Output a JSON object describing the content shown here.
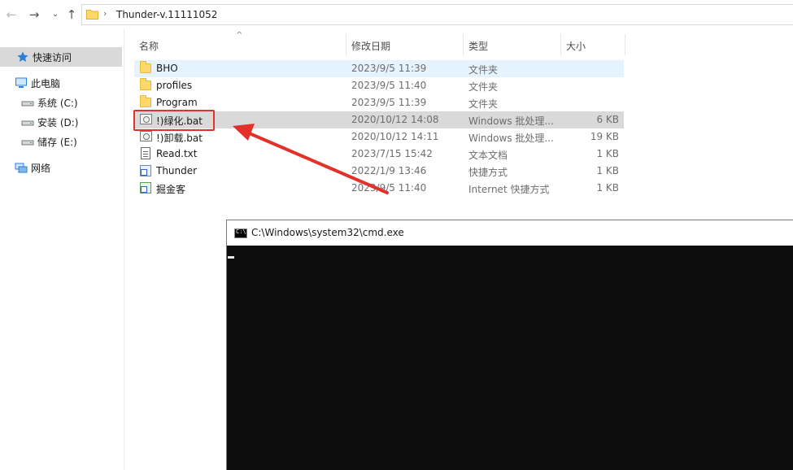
{
  "address": {
    "path": "Thunder-v.11111052"
  },
  "sidebar": {
    "items": [
      {
        "label": "快速访问",
        "icon": "star-icon"
      },
      {
        "label": "此电脑",
        "icon": "computer-icon"
      },
      {
        "label": "系统 (C:)",
        "icon": "drive-icon"
      },
      {
        "label": "安装 (D:)",
        "icon": "drive-icon"
      },
      {
        "label": "储存 (E:)",
        "icon": "drive-icon"
      },
      {
        "label": "网络",
        "icon": "network-icon"
      }
    ]
  },
  "columns": {
    "name": "名称",
    "date": "修改日期",
    "type": "类型",
    "size": "大小"
  },
  "files": [
    {
      "name": "BHO",
      "date": "2023/9/5 11:39",
      "type": "文件夹",
      "size": "",
      "icon": "folder-icon"
    },
    {
      "name": "profiles",
      "date": "2023/9/5 11:40",
      "type": "文件夹",
      "size": "",
      "icon": "folder-icon"
    },
    {
      "name": "Program",
      "date": "2023/9/5 11:39",
      "type": "文件夹",
      "size": "",
      "icon": "folder-icon"
    },
    {
      "name": "!)绿化.bat",
      "date": "2020/10/12 14:08",
      "type": "Windows 批处理...",
      "size": "6 KB",
      "icon": "batch-file-icon"
    },
    {
      "name": "!)卸载.bat",
      "date": "2020/10/12 14:11",
      "type": "Windows 批处理...",
      "size": "19 KB",
      "icon": "batch-file-icon"
    },
    {
      "name": "Read.txt",
      "date": "2023/7/15 15:42",
      "type": "文本文档",
      "size": "1 KB",
      "icon": "text-file-icon"
    },
    {
      "name": "Thunder",
      "date": "2022/1/9 13:46",
      "type": "快捷方式",
      "size": "1 KB",
      "icon": "shortcut-icon"
    },
    {
      "name": "掘金客",
      "date": "2023/9/5 11:40",
      "type": "Internet 快捷方式",
      "size": "1 KB",
      "icon": "internet-shortcut-icon"
    }
  ],
  "cmd": {
    "title": "C:\\Windows\\system32\\cmd.exe",
    "icon_label": "C:\\"
  },
  "colors": {
    "highlight": "#e3302b",
    "selected_row": "#d9d9d9",
    "hover_row": "#e5f3ff",
    "console_bg": "#0c0c0c"
  }
}
